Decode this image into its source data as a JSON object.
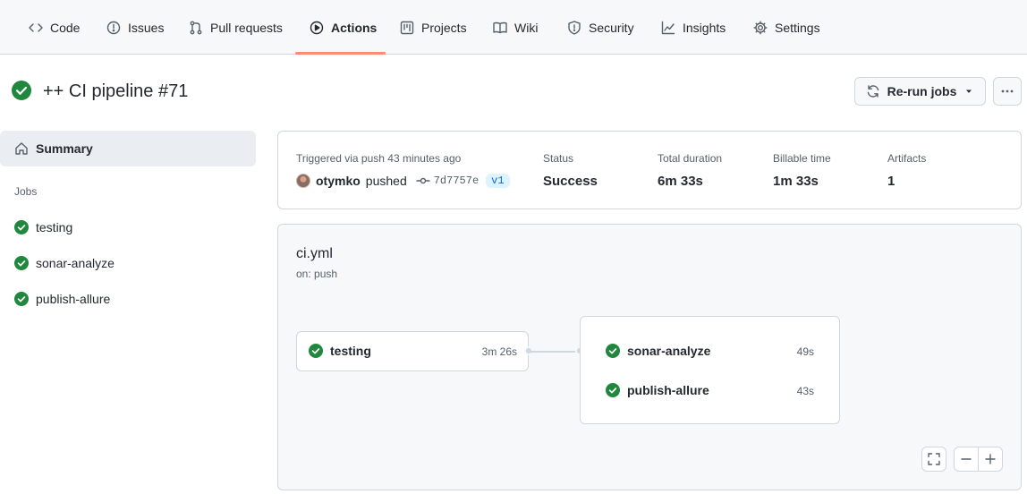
{
  "nav": {
    "tabs": [
      {
        "label": "Code",
        "icon": "code-icon"
      },
      {
        "label": "Issues",
        "icon": "issue-icon"
      },
      {
        "label": "Pull requests",
        "icon": "pull-request-icon"
      },
      {
        "label": "Actions",
        "icon": "play-icon",
        "active": true
      },
      {
        "label": "Projects",
        "icon": "project-icon"
      },
      {
        "label": "Wiki",
        "icon": "book-icon"
      },
      {
        "label": "Security",
        "icon": "shield-icon"
      },
      {
        "label": "Insights",
        "icon": "graph-icon"
      },
      {
        "label": "Settings",
        "icon": "gear-icon"
      }
    ]
  },
  "header": {
    "title": "++ CI pipeline #71",
    "status_icon": "check-circle-icon",
    "rerun_label": "Re-run jobs",
    "more_icon": "kebab-horizontal-icon"
  },
  "sidebar": {
    "summary_label": "Summary",
    "jobs_heading": "Jobs",
    "jobs": [
      {
        "label": "testing",
        "status": "success"
      },
      {
        "label": "sonar-analyze",
        "status": "success"
      },
      {
        "label": "publish-allure",
        "status": "success"
      }
    ]
  },
  "summary": {
    "triggered_text": "Triggered via push 43 minutes ago",
    "actor": "otymko",
    "action": "pushed",
    "commit": "7d7757e",
    "branch": "v1",
    "status_label": "Status",
    "status_value": "Success",
    "duration_label": "Total duration",
    "duration_value": "6m 33s",
    "billable_label": "Billable time",
    "billable_value": "1m 33s",
    "artifacts_label": "Artifacts",
    "artifacts_value": "1"
  },
  "workflow": {
    "file": "ci.yml",
    "trigger": "on: push",
    "stage1": [
      {
        "name": "testing",
        "duration": "3m 26s"
      }
    ],
    "stage2": [
      {
        "name": "sonar-analyze",
        "duration": "49s"
      },
      {
        "name": "publish-allure",
        "duration": "43s"
      }
    ]
  },
  "colors": {
    "success": "#1f883d",
    "accent_underline": "#fd8c73",
    "link": "#0969da"
  }
}
